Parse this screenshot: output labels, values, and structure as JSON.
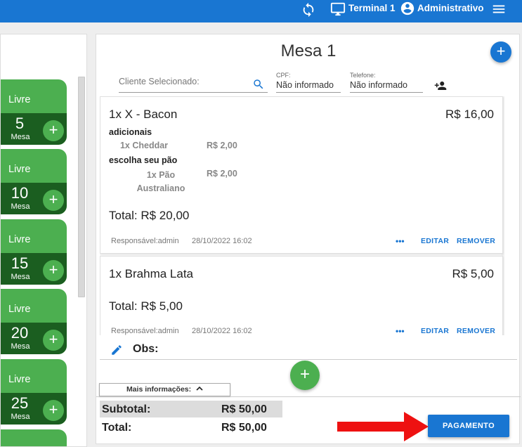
{
  "topbar": {
    "terminal": "Terminal 1",
    "user": "Administrativo",
    "bg": "#1976d2"
  },
  "tables": [
    {
      "status": "Livre",
      "number": "5",
      "label": "Mesa"
    },
    {
      "status": "Livre",
      "number": "10",
      "label": "Mesa"
    },
    {
      "status": "Livre",
      "number": "15",
      "label": "Mesa"
    },
    {
      "status": "Livre",
      "number": "20",
      "label": "Mesa"
    },
    {
      "status": "Livre",
      "number": "25",
      "label": "Mesa"
    }
  ],
  "order": {
    "title": "Mesa 1",
    "cliente_placeholder": "Cliente Selecionado:",
    "cpf_label": "CPF:",
    "cpf_value": "Não informado",
    "telefone_label": "Telefone:",
    "telefone_value": "Não informado",
    "items": [
      {
        "name": "1x X - Bacon",
        "price": "R$ 16,00",
        "groups": [
          {
            "title": "adicionais",
            "subitems": [
              {
                "name": "1x Cheddar",
                "price": "R$ 2,00"
              }
            ]
          },
          {
            "title": "escolha seu pão",
            "subitems": [
              {
                "name": "1x Pão Australiano",
                "price": "R$ 2,00"
              }
            ]
          }
        ],
        "total": "Total: R$ 20,00",
        "responsavel": "Responsável:admin",
        "datetime": "28/10/2022 16:02",
        "dots": "•••",
        "edit": "EDITAR",
        "remove": "REMOVER"
      },
      {
        "name": "1x Brahma Lata",
        "price": "R$ 5,00",
        "total": "Total: R$ 5,00",
        "responsavel": "Responsável:admin",
        "datetime": "28/10/2022 16:02",
        "dots": "•••",
        "edit": "EDITAR",
        "remove": "REMOVER"
      }
    ],
    "obs_label": "Obs:",
    "more_info": "Mais informações:",
    "subtotal_label": "Subtotal:",
    "subtotal_value": "R$ 50,00",
    "total_label": "Total:",
    "total_value": "R$ 50,00",
    "pay_button": "PAGAMENTO"
  },
  "colors": {
    "accent": "#1976d2",
    "green": "#4caf50",
    "dark_green": "#1b5e20",
    "arrow": "#ee1111"
  }
}
